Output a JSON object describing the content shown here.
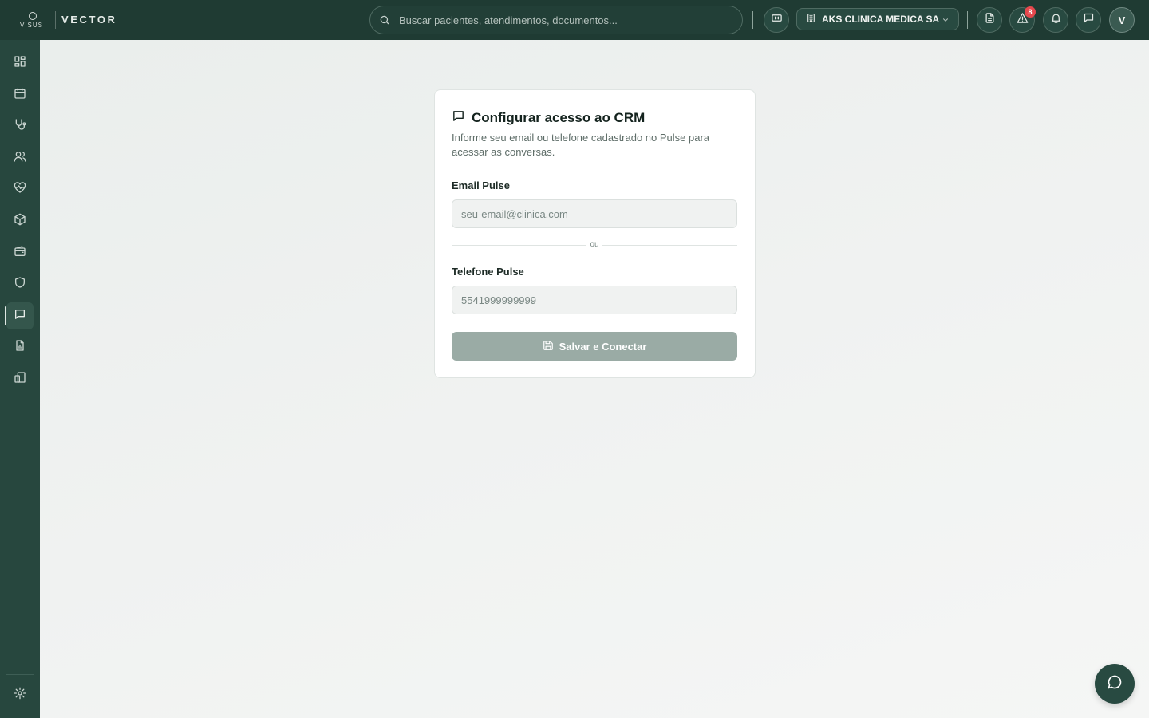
{
  "brand": {
    "logo_text": "VISUS",
    "product_name": "VECTOR"
  },
  "header": {
    "search_placeholder": "Buscar pacientes, atendimentos, documentos...",
    "clinic_name": "AKS CLINICA MEDICA SA",
    "alerts_count": "8",
    "avatar_initial": "V"
  },
  "sidebar": {
    "items": [
      {
        "icon": "dashboard-icon"
      },
      {
        "icon": "calendar-icon"
      },
      {
        "icon": "stethoscope-icon"
      },
      {
        "icon": "users-icon"
      },
      {
        "icon": "heart-pulse-icon"
      },
      {
        "icon": "package-icon"
      },
      {
        "icon": "wallet-icon"
      },
      {
        "icon": "shield-icon"
      },
      {
        "icon": "message-icon",
        "active": true
      },
      {
        "icon": "report-icon"
      },
      {
        "icon": "devices-icon"
      }
    ],
    "footer_icon": "settings-icon"
  },
  "card": {
    "title": "Configurar acesso ao CRM",
    "description": "Informe seu email ou telefone cadastrado no Pulse para acessar as conversas.",
    "email_label": "Email Pulse",
    "email_value": "",
    "email_placeholder": "seu-email@clinica.com",
    "divider_text": "ou",
    "phone_label": "Telefone Pulse",
    "phone_value": "",
    "phone_placeholder": "5541999999999",
    "save_label": "Salvar e Conectar"
  },
  "colors": {
    "topbar": "#1f3b33",
    "sidebar": "#27473e",
    "accent_disabled": "#9aaba5",
    "badge": "#e5484d"
  }
}
